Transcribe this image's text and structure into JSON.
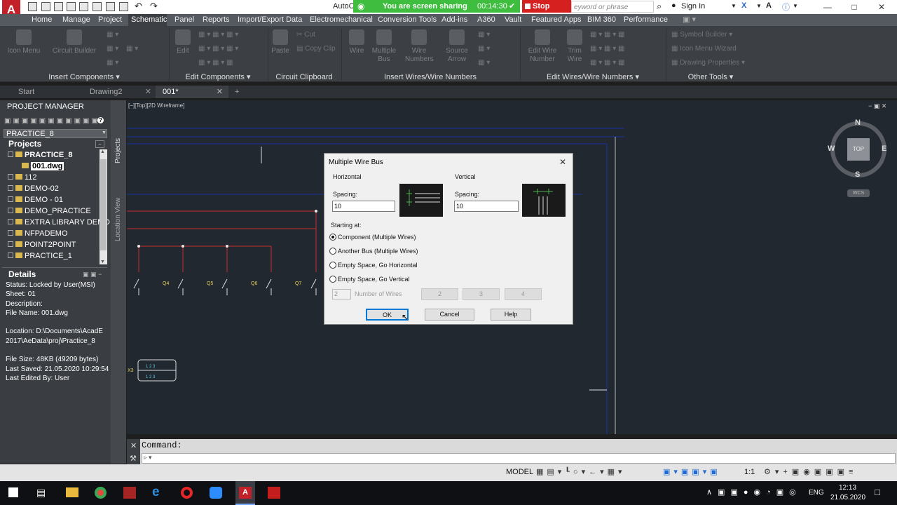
{
  "title_bar": {
    "app_name": "AutoC",
    "share_text": "You are screen sharing",
    "share_time": "00:14:30",
    "stop_share": "Stop Share",
    "search_placeholder": "eyword or phrase",
    "sign_in": "Sign In"
  },
  "ribbon": {
    "tabs": [
      "Home",
      "Manage",
      "Project",
      "Schematic",
      "Panel",
      "Reports",
      "Import/Export Data",
      "Electromechanical",
      "Conversion Tools",
      "Add-ins",
      "A360",
      "Vault",
      "Featured Apps",
      "BIM 360",
      "Performance"
    ],
    "active_tab": "Schematic",
    "buttons": {
      "icon_menu": "Icon Menu",
      "circuit_builder": "Circuit Builder",
      "edit": "Edit",
      "paste": "Paste",
      "cut": "Cut",
      "copy_clip": "Copy Clip",
      "wire": "Wire",
      "multiple_bus": "Multiple Bus",
      "wire_numbers": "Wire Numbers",
      "source_arrow": "Source Arrow",
      "edit_wire_number": "Edit Wire Number",
      "trim_wire": "Trim Wire",
      "symbol_builder": "Symbol Builder",
      "icon_menu_wizard": "Icon Menu Wizard",
      "drawing_properties": "Drawing Properties"
    },
    "panels": {
      "insert_components": "Insert Components",
      "edit_components": "Edit Components",
      "circuit_clipboard": "Circuit Clipboard",
      "insert_wires": "Insert Wires/Wire Numbers",
      "edit_wires": "Edit Wires/Wire Numbers",
      "other_tools": "Other Tools"
    }
  },
  "doc_tabs": [
    "Start",
    "Drawing2",
    "001*"
  ],
  "project_manager": {
    "title": "PROJECT MANAGER",
    "project_select": "PRACTICE_8",
    "projects_label": "Projects",
    "tree": [
      "PRACTICE_8",
      "001.dwg",
      "112",
      "DEMO-02",
      "DEMO - 01",
      "DEMO_PRACTICE",
      "EXTRA LIBRARY DEMO",
      "NFPADEMO",
      "POINT2POINT",
      "PRACTICE_1"
    ],
    "details_label": "Details",
    "details": {
      "status": "Status: Locked by User(MSI)",
      "sheet": "Sheet: 01",
      "description": "Description:",
      "file_name": "File Name: 001.dwg",
      "location1": "Location: D:\\Documents\\AcadE",
      "location2": "2017\\AeData\\proj\\Practice_8",
      "file_size": "File Size: 48KB (49209 bytes)",
      "last_saved": "Last Saved: 21.05.2020 10:29:54",
      "last_edited": "Last Edited By: User"
    },
    "side_tabs": [
      "Projects",
      "Location View"
    ]
  },
  "viewport": {
    "label": "[−][Top][2D Wireframe]",
    "wires": [
      "Q4",
      "Q5",
      "Q6",
      "Q7"
    ],
    "terminal_label": "X3",
    "terminal_row1": "1  2  3",
    "terminal_row2": "1  2  3",
    "viewcube": {
      "n": "N",
      "s": "S",
      "e": "E",
      "w": "W",
      "top": "TOP",
      "wcs": "WCS"
    }
  },
  "dialog": {
    "title": "Multiple Wire Bus",
    "horizontal_label": "Horizontal",
    "vertical_label": "Vertical",
    "spacing_label": "Spacing:",
    "h_spacing": "10",
    "v_spacing": "10",
    "starting_at": "Starting at:",
    "options": [
      "Component (Multiple Wires)",
      "Another Bus (Multiple Wires)",
      "Empty Space, Go Horizontal",
      "Empty Space, Go Vertical"
    ],
    "selected_option": 0,
    "num_wires_value": "2",
    "num_wires_label": "Number of Wires",
    "wire_buttons": [
      "2",
      "3",
      "4"
    ],
    "ok": "OK",
    "cancel": "Cancel",
    "help": "Help"
  },
  "command": {
    "label": "Command:"
  },
  "status_bar": {
    "model": "MODEL",
    "scale": "1:1"
  },
  "taskbar": {
    "lang": "ENG",
    "time": "12:13",
    "date": "21.05.2020"
  }
}
